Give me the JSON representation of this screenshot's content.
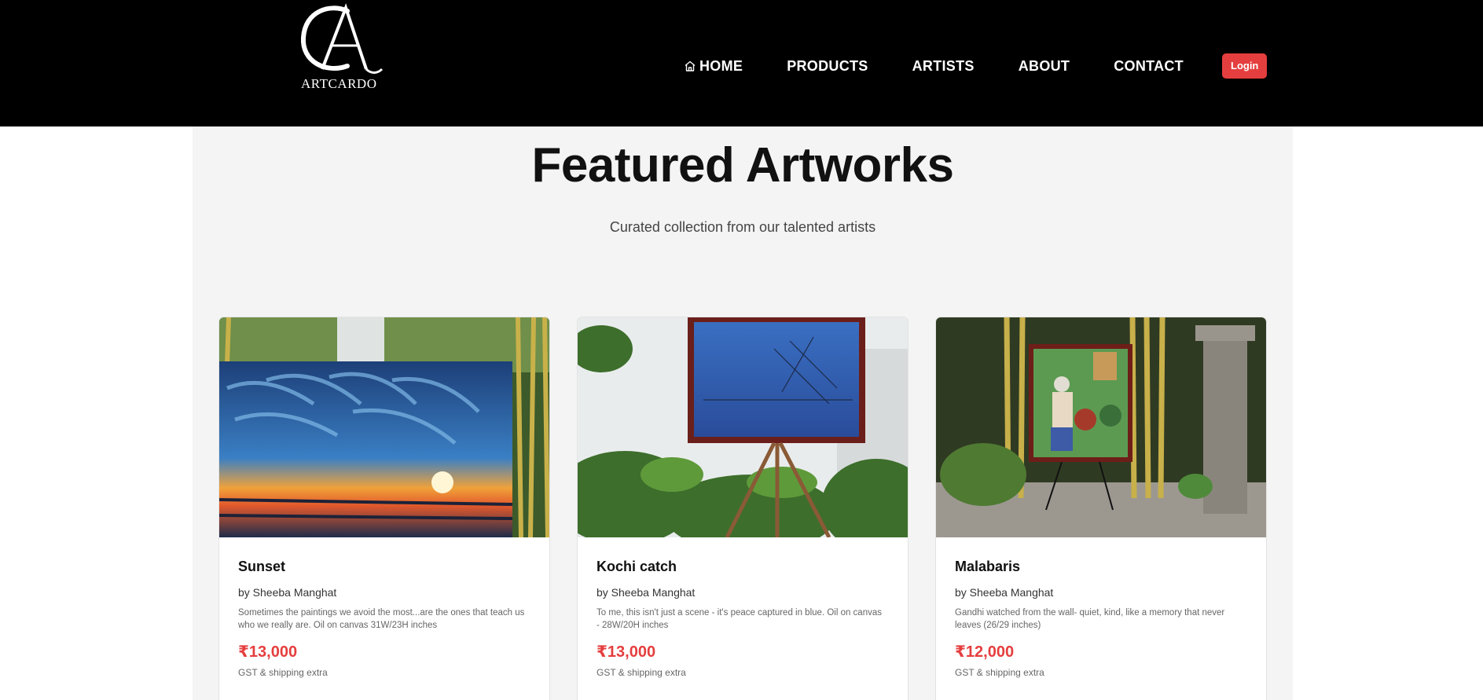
{
  "brand": {
    "monogram": "CA",
    "name": "ARTCARDO"
  },
  "nav": {
    "home": "HOME",
    "products": "PRODUCTS",
    "artists": "ARTISTS",
    "about": "ABOUT",
    "contact": "CONTACT",
    "login": "Login"
  },
  "hero": {
    "title": "Featured Artworks",
    "subtitle": "Curated collection from our talented artists"
  },
  "artworks": [
    {
      "title": "Sunset",
      "artist": "by Sheeba Manghat",
      "description": "Sometimes the paintings we avoid the most...are the ones that teach us who we really are. Oil on canvas 31W/23H inches",
      "price": "₹13,000",
      "note": "GST & shipping extra"
    },
    {
      "title": "Kochi catch",
      "artist": "by Sheeba Manghat",
      "description": "To me, this isn't just a scene - it's peace captured in blue. Oil on canvas - 28W/20H inches",
      "price": "₹13,000",
      "note": "GST & shipping extra"
    },
    {
      "title": "Malabaris",
      "artist": "by Sheeba Manghat",
      "description": "Gandhi watched from the wall- quiet, kind, like a memory that never leaves (26/29 inches)",
      "price": "₹12,000",
      "note": "GST & shipping extra"
    }
  ],
  "colors": {
    "accent": "#e53e3e",
    "header_bg": "#000000",
    "section_bg": "#f4f4f4"
  }
}
